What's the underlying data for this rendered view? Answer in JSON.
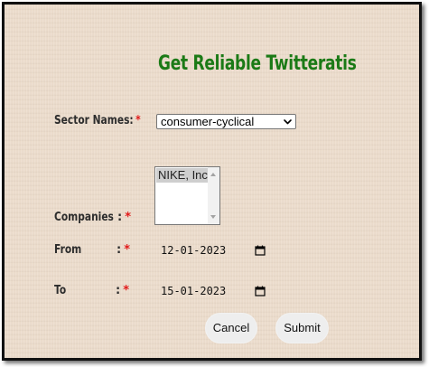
{
  "page": {
    "title": "Get Reliable Twitteratis"
  },
  "form": {
    "sector": {
      "label": "Sector Names:",
      "required_mark": "*",
      "selected_value": "consumer-cyclical"
    },
    "companies": {
      "label": "Companies",
      "colon": ":",
      "required_mark": "*",
      "options": [
        "NIKE, Inc"
      ]
    },
    "from": {
      "label": "From",
      "colon": ":",
      "required_mark": "*",
      "value": "12-01-2023"
    },
    "to": {
      "label": "To",
      "colon": ":",
      "required_mark": "*",
      "value": "15-01-2023"
    }
  },
  "buttons": {
    "cancel_label": "Cancel",
    "submit_label": "Submit"
  },
  "colors": {
    "title": "#1b7a16",
    "required": "#e21a1a",
    "background": "#ecdccb",
    "button_bg": "#eeeeee"
  },
  "icons": {
    "select_arrow": "chevron-down-icon",
    "date_picker": "calendar-icon",
    "scroll_up": "scroll-up-arrow-icon",
    "scroll_down": "scroll-down-arrow-icon"
  }
}
